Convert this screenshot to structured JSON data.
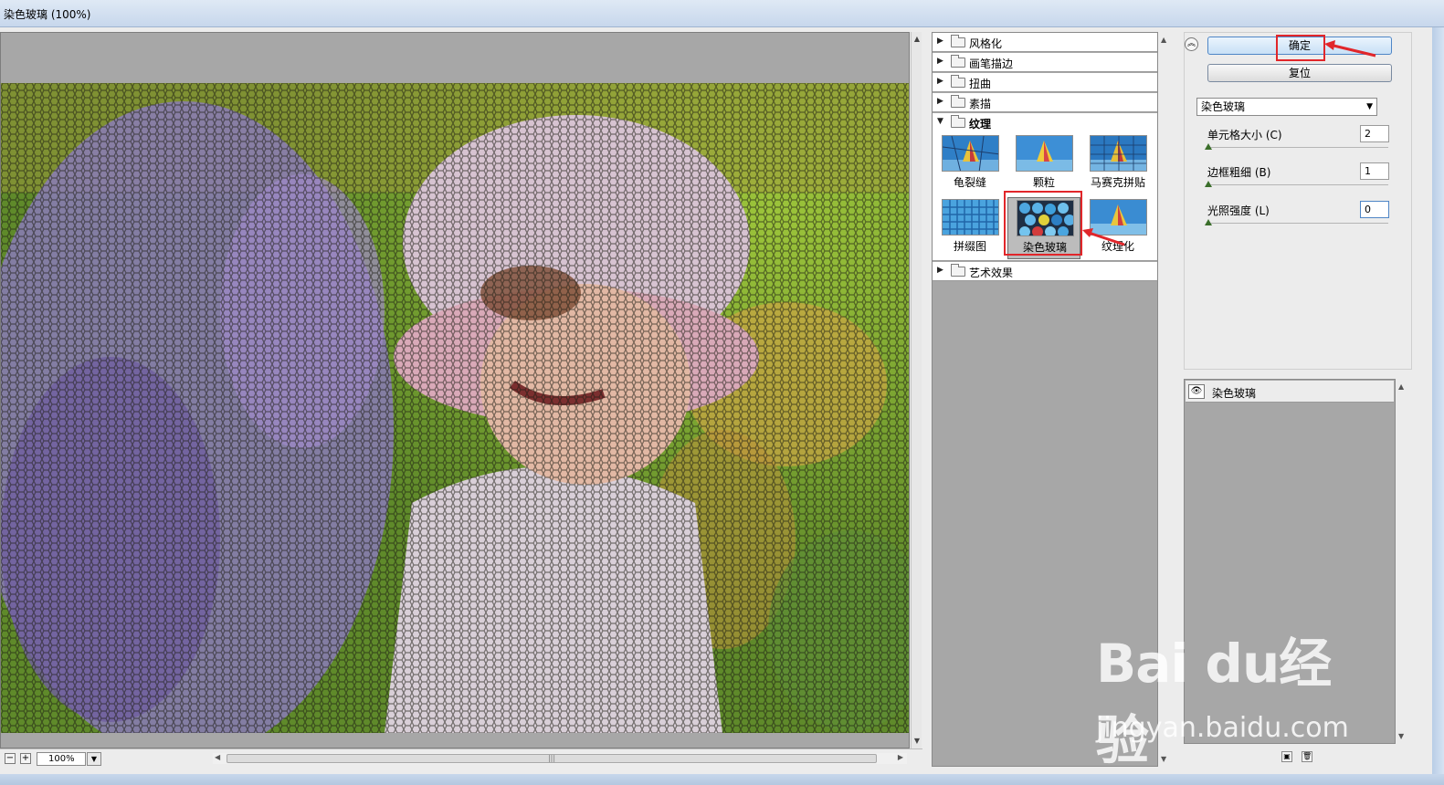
{
  "window": {
    "title": "染色玻璃 (100%)"
  },
  "preview": {
    "zoom": "100%",
    "zoom_out": "−",
    "zoom_in": "+"
  },
  "gallery": {
    "categories": [
      {
        "label": "风格化",
        "expanded": false
      },
      {
        "label": "画笔描边",
        "expanded": false
      },
      {
        "label": "扭曲",
        "expanded": false
      },
      {
        "label": "素描",
        "expanded": false
      },
      {
        "label": "纹理",
        "expanded": true
      },
      {
        "label": "艺术效果",
        "expanded": false
      }
    ],
    "texture_filters": [
      {
        "label": "龟裂缝",
        "selected": false
      },
      {
        "label": "颗粒",
        "selected": false
      },
      {
        "label": "马赛克拼贴",
        "selected": false
      },
      {
        "label": "拼缀图",
        "selected": false
      },
      {
        "label": "染色玻璃",
        "selected": true
      },
      {
        "label": "纹理化",
        "selected": false
      }
    ]
  },
  "actions": {
    "ok": "确定",
    "reset": "复位"
  },
  "filter_select": {
    "selected": "染色玻璃"
  },
  "params": [
    {
      "label": "单元格大小 (C)",
      "value": "2",
      "fraction": 0.0
    },
    {
      "label": "边框粗细 (B)",
      "value": "1",
      "fraction": 0.0
    },
    {
      "label": "光照强度 (L)",
      "value": "0",
      "fraction": 0.0
    }
  ],
  "layers": [
    {
      "label": "染色玻璃",
      "visible": true
    }
  ],
  "watermark": {
    "logo": "Bai du经验",
    "url": "jingyan.baidu.com"
  },
  "colors": {
    "highlight": "#e1262a",
    "ok_button": "#c8e0f6",
    "panel": "#a7a7a7"
  }
}
